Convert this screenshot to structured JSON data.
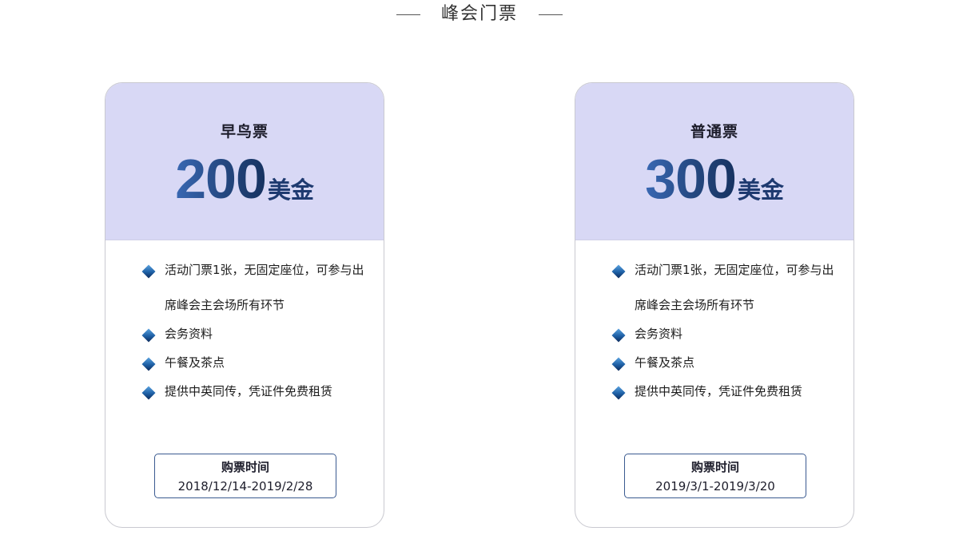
{
  "section": {
    "title": "峰会门票"
  },
  "tickets": [
    {
      "name": "早鸟票",
      "price": "200",
      "unit": "美金",
      "features": [
        "活动门票1张，无固定座位，可参与出席峰会主会场所有环节",
        "会务资料",
        "午餐及茶点",
        "提供中英同传，凭证件免费租赁"
      ],
      "time_label": "购票时间",
      "time_range": "2018/12/14-2019/2/28"
    },
    {
      "name": "普通票",
      "price": "300",
      "unit": "美金",
      "features": [
        "活动门票1张，无固定座位，可参与出席峰会主会场所有环节",
        "会务资料",
        "午餐及茶点",
        "提供中英同传，凭证件免费租赁"
      ],
      "time_label": "购票时间",
      "time_range": "2019/3/1-2019/3/20"
    }
  ],
  "colors": {
    "card_top_bg": "#d8d8f5",
    "price_gradient_start": "#3968b3",
    "price_gradient_end": "#163260",
    "box_border": "#3a5a90"
  },
  "icons": {
    "bullet": "diamond-bullet-icon"
  }
}
